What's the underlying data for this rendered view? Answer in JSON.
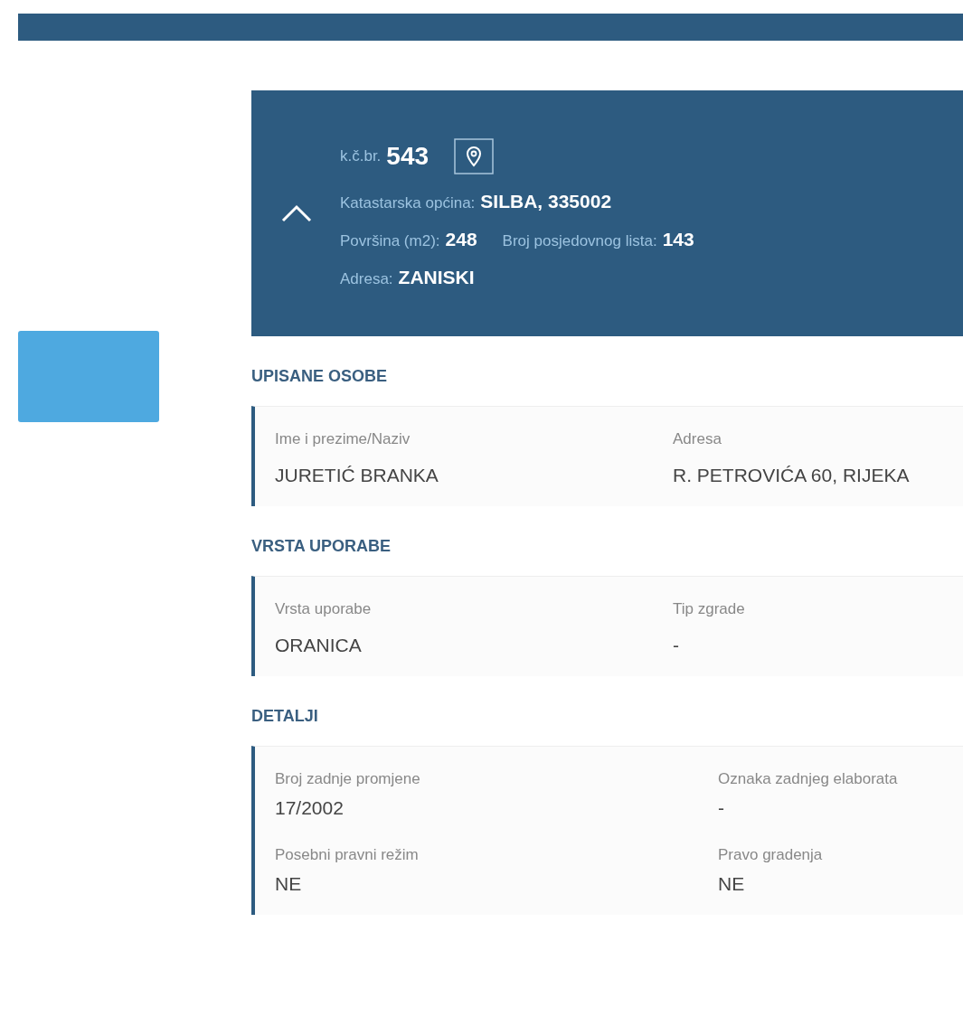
{
  "parcel": {
    "number_label": "k.č.br.",
    "number": "543",
    "expanded": true,
    "rows": [
      [
        {
          "label": "Katastarska općina:",
          "value": "SILBA, 335002"
        }
      ],
      [
        {
          "label": "Površina (m2):",
          "value": "248"
        },
        {
          "label": "Broj posjedovnog lista:",
          "value": "143"
        }
      ],
      [
        {
          "label": "Adresa:",
          "value": "ZANISKI"
        }
      ]
    ]
  },
  "sections": [
    {
      "title": "UPISANE OSOBE",
      "fields": [
        {
          "label": "Ime i prezime/Naziv",
          "value": "JURETIĆ BRANKA"
        },
        {
          "label": "Adresa",
          "value": "R. PETROVIĆA 60, RIJEKA"
        }
      ]
    },
    {
      "title": "VRSTA UPORABE",
      "fields": [
        {
          "label": "Vrsta uporabe",
          "value": "ORANICA"
        },
        {
          "label": "Tip zgrade",
          "value": "-"
        }
      ]
    },
    {
      "title": "DETALJI",
      "fields": [
        {
          "label": "Broj zadnje promjene",
          "value": "17/2002"
        },
        {
          "label": "Oznaka zadnjeg elaborata",
          "value": "-"
        },
        {
          "label": "Posebni pravni režim",
          "value": "NE"
        },
        {
          "label": "Pravo gradenja",
          "value": "NE"
        }
      ]
    }
  ]
}
